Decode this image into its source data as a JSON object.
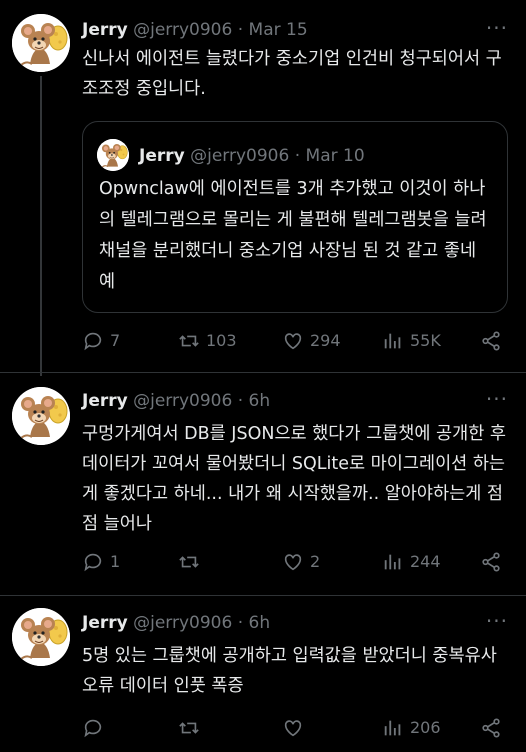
{
  "tweets": [
    {
      "name": "Jerry",
      "handle": "@jerry0906",
      "time": "Mar 15",
      "text": "신나서 에이전트 늘렸다가 중소기업 인건비 청구되어서 구조조정 중입니다.",
      "quote": {
        "name": "Jerry",
        "handle": "@jerry0906",
        "time": "Mar 10",
        "text": "Opwnclaw에 에이전트를 3개 추가했고 이것이 하나의 텔레그램으로 몰리는 게 불편해 텔레그램봇을 늘려 채널을 분리했더니 중소기업 사장님 된 것 같고 좋네예"
      },
      "replies": "7",
      "retweets": "103",
      "likes": "294",
      "views": "55K"
    },
    {
      "name": "Jerry",
      "handle": "@jerry0906",
      "time": "6h",
      "text": "구멍가게여서 DB를 JSON으로 했다가 그룹챗에 공개한 후 데이터가 꼬여서 물어봤더니 SQLite로 마이그레이션 하는게 좋겠다고 하네... 내가 왜 시작했을까.. 알아야하는게 점점 늘어나",
      "replies": "1",
      "retweets": "",
      "likes": "2",
      "views": "244"
    },
    {
      "name": "Jerry",
      "handle": "@jerry0906",
      "time": "6h",
      "text": "5명 있는 그룹챗에 공개하고 입력값을 받았더니 중복유사오류  데이터 인풋 폭증",
      "replies": "",
      "retweets": "",
      "likes": "",
      "views": "206"
    }
  ],
  "separator": "·",
  "more": "···"
}
